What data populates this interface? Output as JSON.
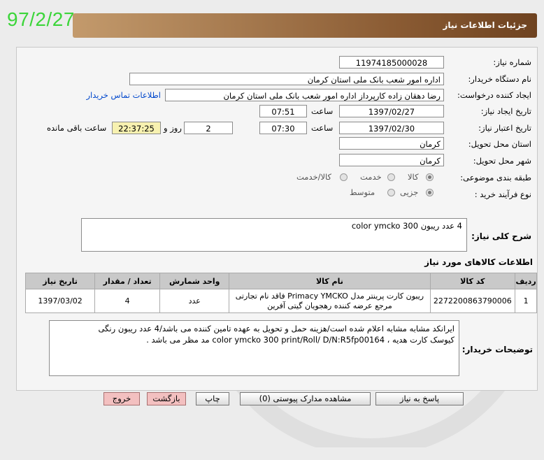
{
  "date_stamp": "97/2/27",
  "header": {
    "title": "جزئیات اطلاعات نیاز"
  },
  "fields": {
    "need_number": {
      "label": "شماره نیاز:",
      "value": "11974185000028"
    },
    "buyer_org": {
      "label": "نام دستگاه خریدار:",
      "value": "اداره امور شعب بانک ملی استان کرمان"
    },
    "requester": {
      "label": "ایجاد کننده درخواست:",
      "value": "رضا دهقان زاده کارپرداز اداره امور شعب بانک ملی استان کرمان",
      "contact_link": "اطلاعات تماس خریدار"
    },
    "create_date": {
      "label": "تاریخ ایجاد نیاز:",
      "date": "1397/02/27",
      "time_label": "ساعت",
      "time": "07:51"
    },
    "valid_date": {
      "label": "تاریخ اعتبار نیاز:",
      "date": "1397/02/30",
      "time_label": "ساعت",
      "time": "07:30",
      "days": "2",
      "days_label": "روز و",
      "remaining": "22:37:25",
      "remaining_label": "ساعت باقی مانده"
    },
    "province": {
      "label": "استان محل تحویل:",
      "value": "کرمان"
    },
    "city": {
      "label": "شهر محل تحویل:",
      "value": "کرمان"
    },
    "category": {
      "label": "طبقه بندی موضوعی:",
      "options": [
        "کالا",
        "خدمت",
        "کالا/خدمت"
      ],
      "selected": "کالا"
    },
    "purchase_type": {
      "label": "نوع فرآیند خرید :",
      "options": [
        "جزیی",
        "متوسط"
      ],
      "selected": "جزیی"
    }
  },
  "summary": {
    "label": "شرح کلی نیاز:",
    "value": "4 عدد ریبون color ymcko 300"
  },
  "items_section": {
    "title": "اطلاعات کالاهای مورد نیاز",
    "columns": [
      "ردیف",
      "کد کالا",
      "نام کالا",
      "واحد شمارش",
      "تعداد / مقدار",
      "تاریخ نیاز"
    ],
    "rows": [
      {
        "row": "1",
        "code": "2272200863790006",
        "name_line1": "ریبون کارت پرینتر مدل Primacy YMCKO فاقد نام تجارتی",
        "name_line2": "مرجع عرضه کننده رهجویان گیتی آفرین",
        "unit": "عدد",
        "qty": "4",
        "date": "1397/03/02"
      }
    ]
  },
  "buyer_notes": {
    "label": "توضیحات خریدار:",
    "line1": "ایرانکد مشابه مشابه اعلام شده است/هزینه حمل و تحویل به عهده تامین کننده می باشد/4 عدد ریبون رنگی",
    "line2": "کیوسک کارت هدیه ، color ymcko 300 print/Roll/  D/N:R5fp00164 مد مظر می باشد ."
  },
  "buttons": {
    "reply": "پاسخ به نیاز",
    "attachments": "مشاهده مدارک پیوستی (0)",
    "print": "چاپ",
    "back": "بازگشت",
    "exit": "خروج"
  },
  "colors": {
    "stamp": "#3cd53a",
    "header_dark": "#6e4220",
    "header_light": "#c39a6c",
    "link": "#0047cc"
  }
}
